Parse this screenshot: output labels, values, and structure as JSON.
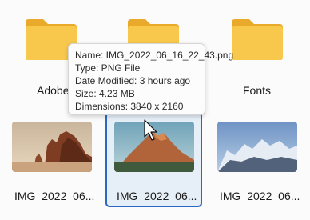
{
  "folders": [
    {
      "label": "Adobe",
      "icon": "folder-icon"
    },
    {
      "label": "",
      "icon": "folder-icon"
    },
    {
      "label": "Fonts",
      "icon": "folder-icon"
    }
  ],
  "files": [
    {
      "label": "IMG_2022_06...",
      "thumbnail": "desert-rock-thumbnail"
    },
    {
      "label": "IMG_2022_06...",
      "thumbnail": "mountain-peak-thumbnail"
    },
    {
      "label": "IMG_2022_06...",
      "thumbnail": "snowy-mountains-thumbnail"
    }
  ],
  "tooltip": {
    "name": "Name: IMG_2022_06_16_22_43.png",
    "type": "Type: PNG File",
    "date_modified": "Date Modified: 3 hours ago",
    "size": "Size: 4.23 MB",
    "dimensions": "Dimensions: 3840 x 2160"
  },
  "colors": {
    "selection_border": "#2b67c4",
    "selection_fill": "#e6eef8",
    "folder_body": "#f8c84c",
    "folder_tab": "#e9a92a"
  }
}
